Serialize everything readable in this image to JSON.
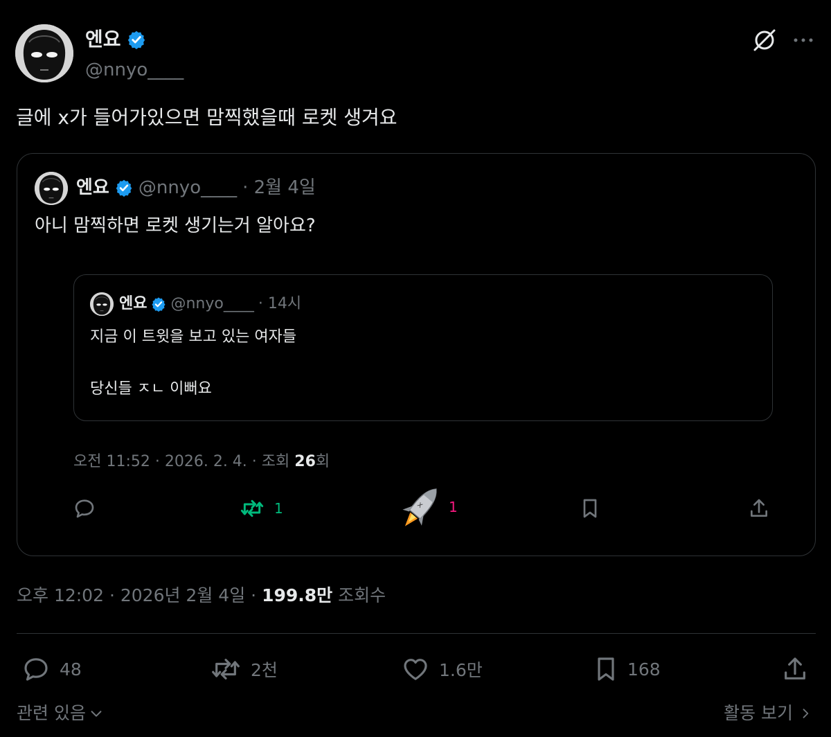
{
  "tweet": {
    "author_name": "엔요",
    "author_handle": "@nnyo____",
    "text": "글에 x가 들어가있으면 맘찍했을때 로켓 생겨요",
    "meta": {
      "time": "오후 12:02",
      "date": "2026년 2월 4일",
      "separator": "·",
      "views_count": "199.8만",
      "views_label": "조회수"
    },
    "actions": {
      "reply_count": "48",
      "retweet_count": "2천",
      "like_count": "1.6만",
      "bookmark_count": "168"
    },
    "related_label": "관련 있음",
    "activity_label": "활동 보기"
  },
  "quote": {
    "author_name": "엔요",
    "author_handle": "@nnyo____",
    "date": "· 2월 4일",
    "text": "아니 맘찍하면 로켓 생기는거 알아요?",
    "meta_time": "오전 11:52 · 2026. 2. 4. · 조회 ",
    "meta_views": "26",
    "meta_views_suffix": "회",
    "actions": {
      "retweet_count": "1",
      "rocket_count": "1"
    }
  },
  "nested_quote": {
    "author_name": "엔요",
    "author_handle": "@nnyo____",
    "time": "· 14시",
    "line1": "지금 이 트윗을 보고 있는 여자들",
    "line2": "당신들 ㅈㄴ 이뻐요"
  },
  "colors": {
    "background": "#000000",
    "text": "#e7e9ea",
    "secondary": "#71767b",
    "verified": "#1d9bf0",
    "retweet_green": "#00ba7c",
    "like_pink": "#f91880",
    "border": "#2f3336"
  },
  "icons": [
    "verified-badge-icon",
    "grok-icon",
    "more-icon",
    "reply-icon",
    "retweet-icon",
    "rocket-icon",
    "bookmark-icon",
    "share-icon",
    "like-icon",
    "chevron-down-icon",
    "chevron-right-icon"
  ]
}
